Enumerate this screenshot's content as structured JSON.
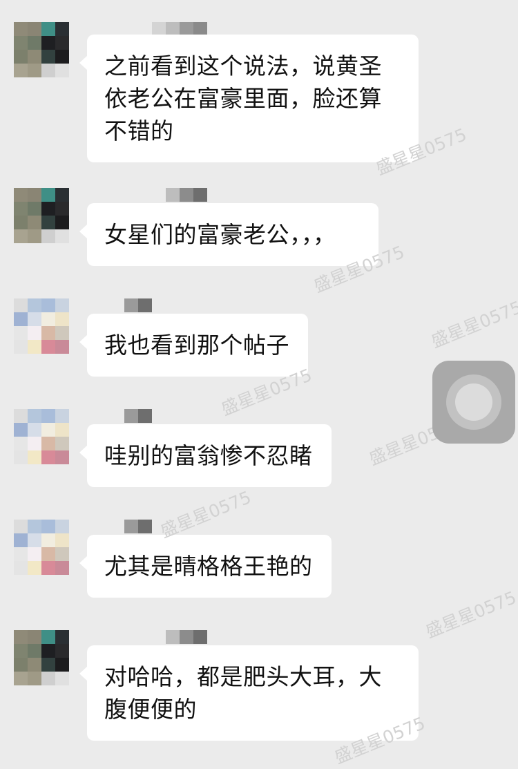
{
  "watermark_text": "盛星星0575",
  "messages": [
    {
      "text": "之前看到这个说法，说黄圣依老公在富豪里面，脸还算不错的"
    },
    {
      "text": "女星们的富豪老公，，，"
    },
    {
      "text": "我也看到那个帖子"
    },
    {
      "text": "哇别的富翁惨不忍睹"
    },
    {
      "text": "尤其是晴格格王艳的"
    },
    {
      "text": "对哈哈，都是肥头大耳，大腹便便的"
    }
  ],
  "avatar_colors": {
    "dark": [
      "#8f8a78",
      "#8a8574",
      "#3f8f86",
      "#2a2f33",
      "#7f8470",
      "#6f7a68",
      "#1e1f22",
      "#2a2a2c",
      "#7c806c",
      "#8e8a76",
      "#32413f",
      "#1c1c1e",
      "#a8a390",
      "#9f9a86",
      "#cfcfcf",
      "#e0e0e0"
    ],
    "light": [
      "#dcdcdc",
      "#b4c6dc",
      "#a9bdda",
      "#c9d3e0",
      "#9fb2d3",
      "#d6dde8",
      "#f1ede0",
      "#eee4c8",
      "#e6e6e6",
      "#f4eef2",
      "#d8b9a6",
      "#cfc8bc",
      "#e4e4e4",
      "#f2e8c6",
      "#d88a98",
      "#c98a98"
    ]
  },
  "name_colors": [
    "#d0d0d0",
    "#bcbcbc",
    "#8c8c8c",
    "#6e6e6e"
  ],
  "assistive_touch": {
    "label": "assistive-touch"
  }
}
